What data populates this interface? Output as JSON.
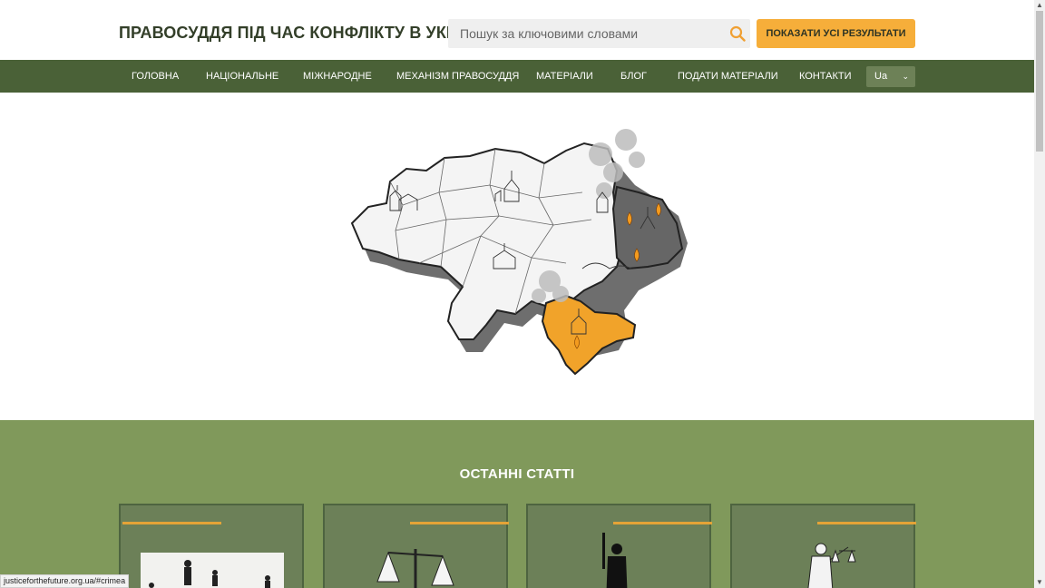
{
  "header": {
    "site_title": "ПРАВОСУДДЯ ПІД ЧАС КОНФЛІКТУ В УКРАЇНІ",
    "search_placeholder": "Пошук за ключовими словами",
    "show_all_label": "ПОКАЗАТИ УСІ РЕЗУЛЬТАТИ"
  },
  "nav": {
    "items": [
      {
        "label": "ГОЛОВНА"
      },
      {
        "label": "НАЦІОНАЛЬНЕ"
      },
      {
        "label": "МІЖНАРОДНЕ"
      },
      {
        "label": "МЕХАНІЗМ ПРАВОСУДДЯ"
      },
      {
        "label": "МАТЕРІАЛИ"
      },
      {
        "label": "БЛОГ"
      },
      {
        "label": "ПОДАТИ МАТЕРІАЛИ"
      },
      {
        "label": "КОНТАКТИ"
      }
    ],
    "language": "Ua"
  },
  "articles": {
    "title": "ОСТАННІ СТАТТІ",
    "cards": [
      {
        "image": "soldiers-silhouette"
      },
      {
        "image": "scales-of-justice"
      },
      {
        "image": "armed-soldier"
      },
      {
        "image": "lady-justice-statue"
      }
    ]
  },
  "status_bar": {
    "url": "justiceforthefuture.org.ua/#crimea"
  },
  "colors": {
    "header_text": "#333f29",
    "nav_bg": "#4a6137",
    "accent": "#f6ae3a",
    "section_bg": "#80995b",
    "card_bg": "#6c8058"
  }
}
